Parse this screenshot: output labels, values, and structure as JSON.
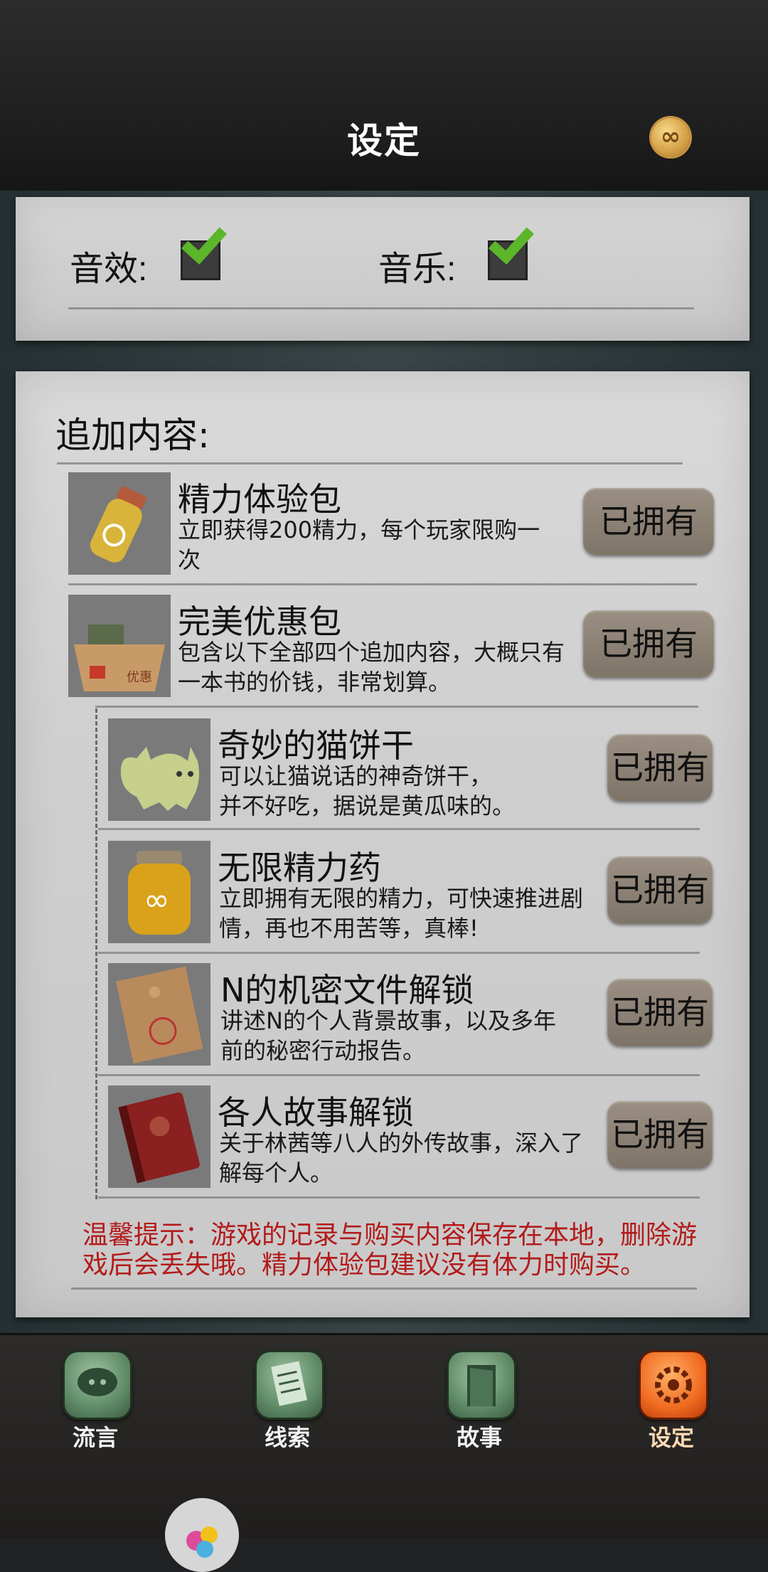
{
  "header": {
    "title": "设定",
    "coin_icon": "infinity-coin-icon"
  },
  "settings": {
    "sound_label": "音效:",
    "music_label": "音乐:",
    "sound_checked": true,
    "music_checked": true
  },
  "content": {
    "section_title": "追加内容:",
    "owned_label": "已拥有",
    "items": [
      {
        "title": "精力体验包",
        "desc": "立即获得200精力，每个玩家限购一次",
        "icon": "potion-bottle-icon"
      },
      {
        "title": "完美优惠包",
        "desc": "包含以下全部四个追加内容，大概只有一本书的价钱，非常划算。",
        "icon": "gift-box-icon"
      },
      {
        "title": "奇妙的猫饼干",
        "desc_line1": "可以让猫说话的神奇饼干，",
        "desc_line2": "并不好吃，据说是黄瓜味的。",
        "icon": "cat-cookie-icon"
      },
      {
        "title": "无限精力药",
        "desc": "立即拥有无限的精力，可快速推进剧情，再也不用苦等，真棒!",
        "icon": "infinity-jar-icon"
      },
      {
        "title": "N的机密文件解锁",
        "desc": "讲述N的个人背景故事，以及多年前的秘密行动报告。",
        "icon": "envelope-icon"
      },
      {
        "title": "各人故事解锁",
        "desc": "关于林茜等八人的外传故事，深入了解每个人。",
        "icon": "red-book-icon"
      }
    ],
    "tip": "温馨提示：游戏的记录与购买内容保存在本地，删除游戏后会丢失哦。精力体验包建议没有体力时购买。"
  },
  "tabs": [
    {
      "label": "流言",
      "icon": "speech-bubble-icon",
      "active": false
    },
    {
      "label": "线索",
      "icon": "notes-icon",
      "active": false
    },
    {
      "label": "故事",
      "icon": "door-icon",
      "active": false
    },
    {
      "label": "设定",
      "icon": "gear-icon",
      "active": true
    }
  ],
  "colors": {
    "tip": "#b31a1a",
    "active_tab": "#f06a20",
    "check": "#5bb62a"
  }
}
